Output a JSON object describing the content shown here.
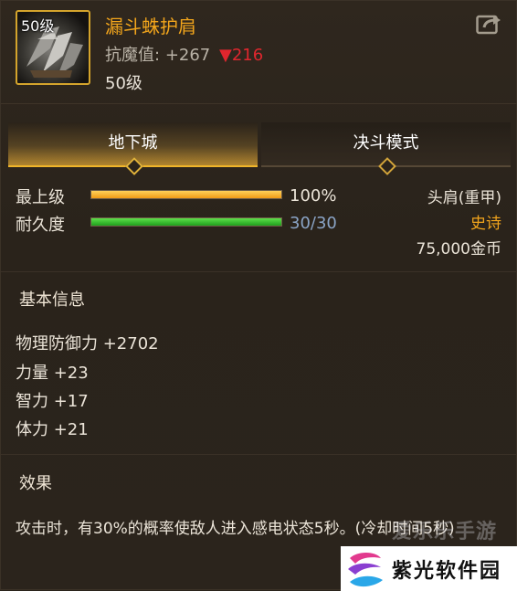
{
  "item": {
    "level_badge": "50级",
    "name": "漏斗蛛护肩",
    "anti_magic_label": "抗魔值:",
    "anti_magic_value": "+267",
    "anti_magic_change_arrow": "▼",
    "anti_magic_change": "216",
    "level_text": "50级",
    "icon": "shoulder-armor-icon"
  },
  "header": {
    "share_icon": "share-icon"
  },
  "tabs": [
    {
      "label": "地下城",
      "active": true
    },
    {
      "label": "决斗模式",
      "active": false
    }
  ],
  "bars": {
    "top_level": {
      "label": "最上级",
      "value_text": "100%",
      "fill": 1.0,
      "color": "#f5a623"
    },
    "durability": {
      "label": "耐久度",
      "value_text": "30/30",
      "fill": 1.0,
      "color": "#2bbb2a"
    }
  },
  "meta": {
    "slot": "头肩(重甲)",
    "rarity": "史诗",
    "rarity_color": "#f2a51c",
    "price": "75,000金币"
  },
  "basic_info": {
    "title": "基本信息",
    "attributes": [
      "物理防御力 +2702",
      "力量 +23",
      "智力 +17",
      "体力 +21"
    ]
  },
  "effect": {
    "title": "效果",
    "text": "攻击时，有30%的概率使敌人进入感电状态5秒。(冷却时间5秒)"
  },
  "watermarks": {
    "overlay_text": "爱乐乐手游",
    "brand_text": "紫光软件园"
  }
}
